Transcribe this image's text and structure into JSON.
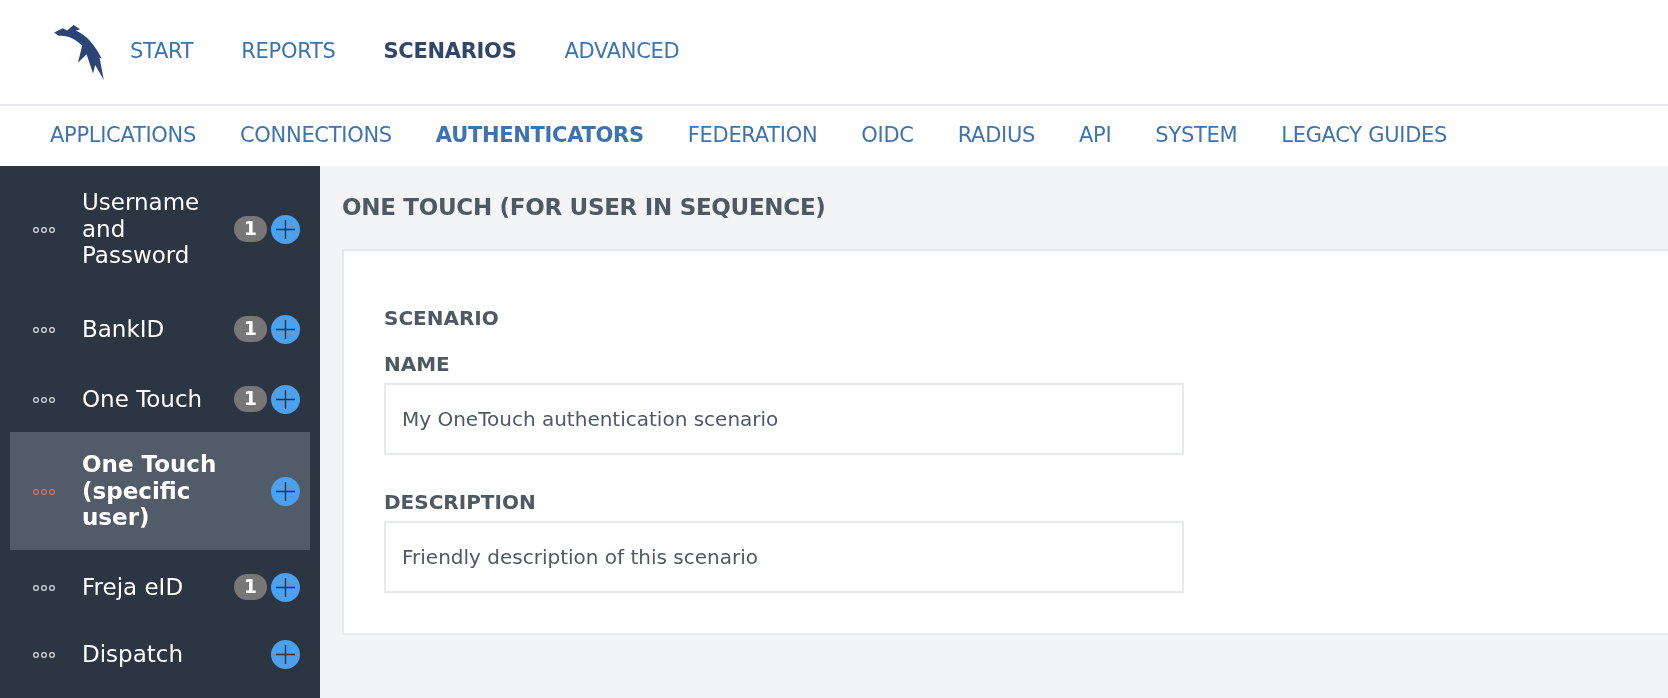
{
  "top_nav": [
    {
      "label": "START",
      "selected": false
    },
    {
      "label": "REPORTS",
      "selected": false
    },
    {
      "label": "SCENARIOS",
      "selected": true
    },
    {
      "label": "ADVANCED",
      "selected": false
    }
  ],
  "sub_nav": [
    {
      "label": "APPLICATIONS",
      "selected": false
    },
    {
      "label": "CONNECTIONS",
      "selected": false
    },
    {
      "label": "AUTHENTICATORS",
      "selected": true
    },
    {
      "label": "FEDERATION",
      "selected": false
    },
    {
      "label": "OIDC",
      "selected": false
    },
    {
      "label": "RADIUS",
      "selected": false
    },
    {
      "label": "API",
      "selected": false
    },
    {
      "label": "SYSTEM",
      "selected": false
    },
    {
      "label": "LEGACY GUIDES",
      "selected": false
    }
  ],
  "sidebar": {
    "items": [
      {
        "label": "Username and Password",
        "count": "1",
        "selected": false
      },
      {
        "label": "BankID",
        "count": "1",
        "selected": false
      },
      {
        "label": "One Touch",
        "count": "1",
        "selected": false
      },
      {
        "label": "One Touch (specific user)",
        "selected": true
      },
      {
        "label": "Freja eID",
        "count": "1",
        "selected": false
      },
      {
        "label": "Dispatch",
        "selected": false
      }
    ]
  },
  "content": {
    "title": "ONE TOUCH (FOR USER IN SEQUENCE)",
    "section": "SCENARIO",
    "fields": [
      {
        "label": "NAME",
        "value": "My OneTouch authentication scenario"
      },
      {
        "label": "DESCRIPTION",
        "value": "Friendly description of this scenario"
      }
    ]
  }
}
